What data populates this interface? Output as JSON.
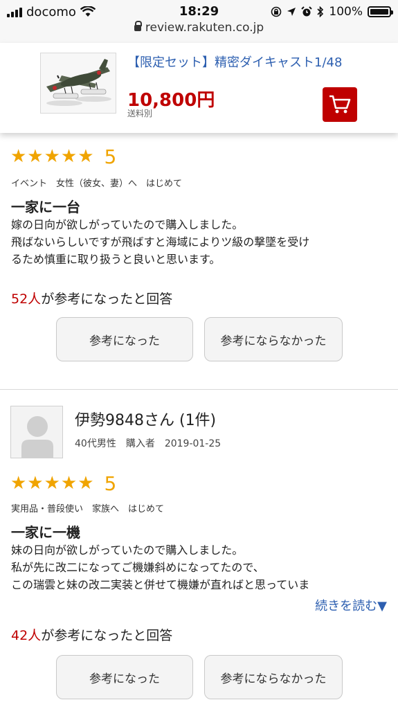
{
  "status_bar": {
    "carrier": "docomo",
    "time": "18:29",
    "battery": "100%",
    "battery_level": 1.0,
    "url": "review.rakuten.co.jp"
  },
  "product": {
    "title": "【限定セット】精密ダイキャスト1/48",
    "price": "10,800円",
    "shipping": "送料別"
  },
  "reviews": [
    {
      "rating": 5,
      "stars": "★★★★★",
      "score": "5",
      "tags": "イベント　女性（彼女、妻）へ　はじめて",
      "title": "一家に一台",
      "body": [
        "嫁の日向が欲しがっていたので購入しました。",
        "飛ばないらしいですが飛ばすと海域によりツ級の撃墜を受け",
        "るため慎重に取り扱うと良いと思います。"
      ],
      "helpful_count": "52人",
      "helpful_text": "が参考になったと回答",
      "vote_yes": "参考になった",
      "vote_no": "参考にならなかった"
    },
    {
      "reviewer_name": "伊勢9848さん (1件)",
      "reviewer_meta": "40代男性　購入者　2019-01-25",
      "rating": 5,
      "stars": "★★★★★",
      "score": "5",
      "tags": "実用品・普段使い　家族へ　はじめて",
      "title": "一家に一機",
      "body": [
        "妹の日向が欲しがっていたので購入しました。",
        "私が先に改二になってご機嫌斜めになってたので、",
        "この瑞雲と妹の改二実装と併せて機嫌が直ればと思っていま"
      ],
      "read_more": "続きを読む▼",
      "helpful_count": "42人",
      "helpful_text": "が参考になったと回答",
      "vote_yes": "参考になった",
      "vote_no": "参考にならなかった"
    }
  ],
  "colors": {
    "brand_red": "#bf0000",
    "star": "#f0a400",
    "link": "#2d5fb0"
  }
}
